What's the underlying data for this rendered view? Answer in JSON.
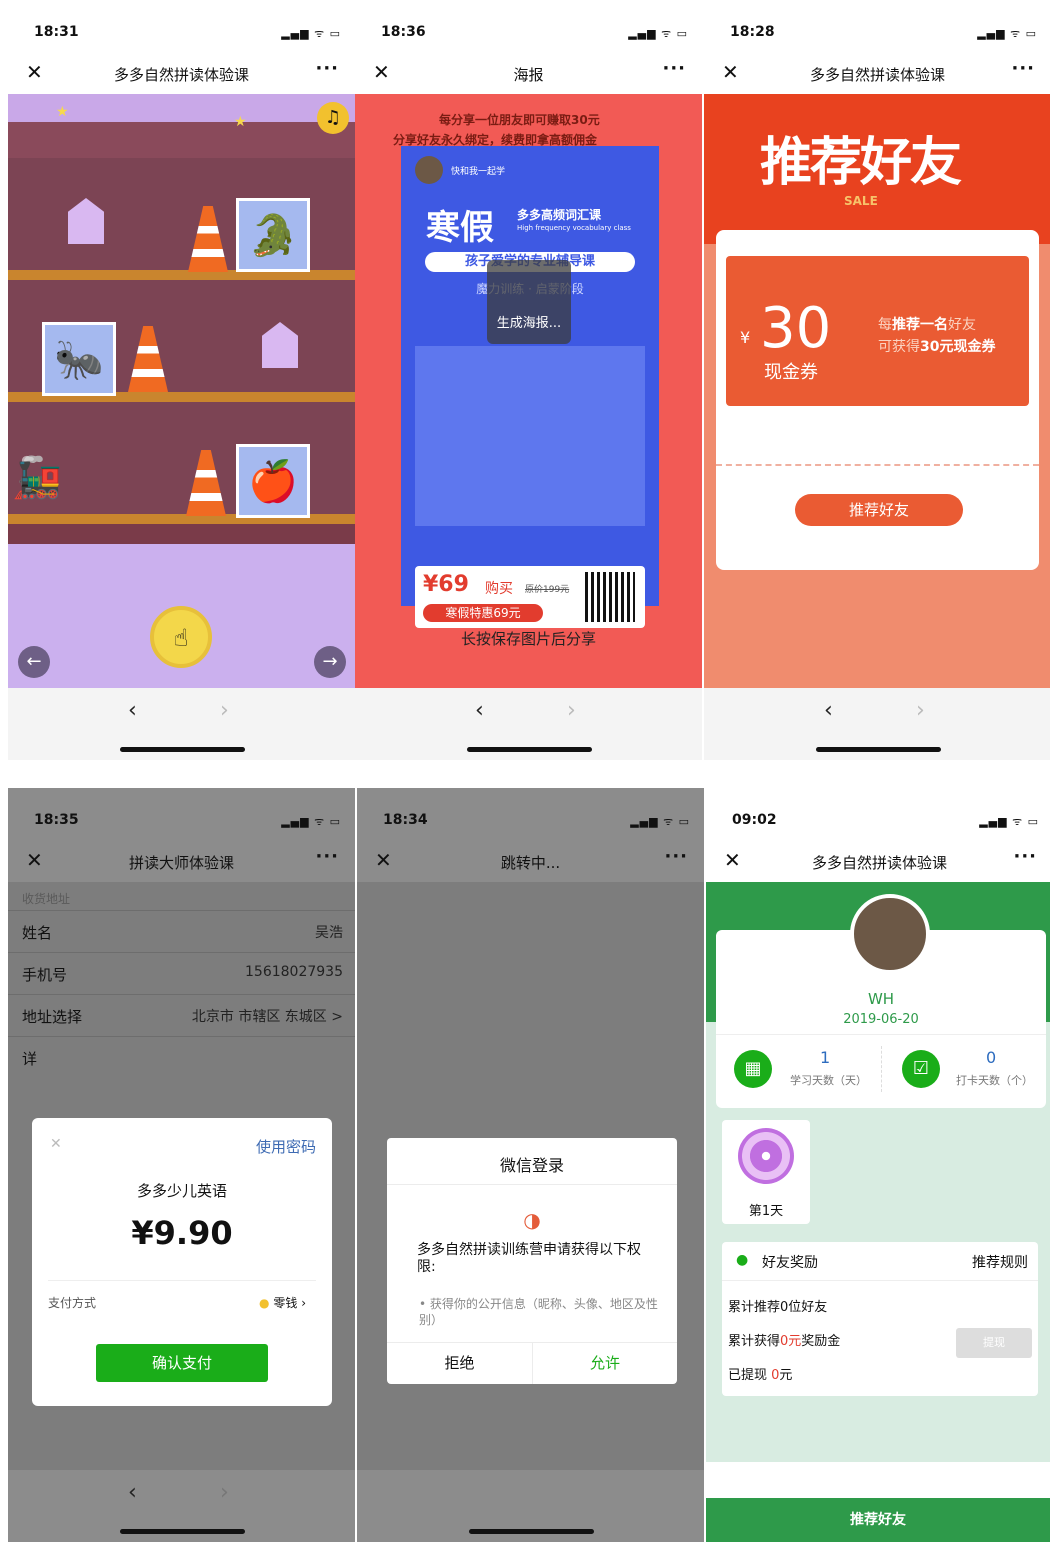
{
  "s1": {
    "time": "18:31",
    "title": "多多自然拼读体验课"
  },
  "s2": {
    "time": "18:36",
    "title": "海报",
    "top1": "每分享一位朋友即可赚取30元",
    "top2": "分享好友永久绑定，续费即拿高额佣金",
    "user": "快和我一起学",
    "poster_title": "寒假",
    "poster_sub": "多多高频词汇课",
    "poster_en": "High frequency vocabulary class",
    "banner": "孩子爱学的专业辅导课",
    "line": "魔力训练 · 启蒙阶段",
    "price": "¥69",
    "buy": "购买",
    "orig": "原价199元",
    "special": "寒假特惠69元",
    "loading": "生成海报...",
    "save": "长按保存图片后分享"
  },
  "s3": {
    "time": "18:28",
    "title": "多多自然拼读体验课",
    "banner": "推荐好友",
    "sale": "SALE",
    "yen": "¥",
    "amount": "30",
    "cash": "现金券",
    "desc1a": "每",
    "desc1b": "推荐一名",
    "desc1c": "好友",
    "desc2a": "可获得",
    "desc2b": "30元现金券",
    "btn": "推荐好友"
  },
  "s4": {
    "time": "18:35",
    "title": "拼读大师体验课",
    "section": "收货地址",
    "rows": [
      {
        "label": "姓名",
        "value": "吴浩"
      },
      {
        "label": "手机号",
        "value": "15618027935"
      },
      {
        "label": "地址选择",
        "value": "北京市 市辖区 东城区 >"
      },
      {
        "label": "详",
        "value": ""
      }
    ],
    "use_pw": "使用密码",
    "product": "多多少儿英语",
    "sum": "¥9.90",
    "payway": "支付方式",
    "coin": "零钱",
    "confirm": "确认支付"
  },
  "s5": {
    "time": "18:34",
    "title": "跳转中...",
    "login_title": "微信登录",
    "app_text": "多多自然拼读训练营申请获得以下权限:",
    "perm": "获得你的公开信息（昵称、头像、地区及性别）",
    "refuse": "拒绝",
    "allow": "允许"
  },
  "s6": {
    "time": "09:02",
    "title": "多多自然拼读体验课",
    "name": "WH",
    "date": "2019-06-20",
    "stat1_num": "1",
    "stat1_lbl": "学习天数（天）",
    "stat2_num": "0",
    "stat2_lbl": "打卡天数（个）",
    "day": "第1天",
    "friend": "好友奖励",
    "rule": "推荐规则",
    "l1": "累计推荐0位好友",
    "l2a": "累计获得",
    "l2b": "0元",
    "l2c": "奖励金",
    "l3a": "已提现 ",
    "l3b": "0",
    "l3c": "元",
    "withdraw": "提现",
    "btn": "推荐好友"
  }
}
